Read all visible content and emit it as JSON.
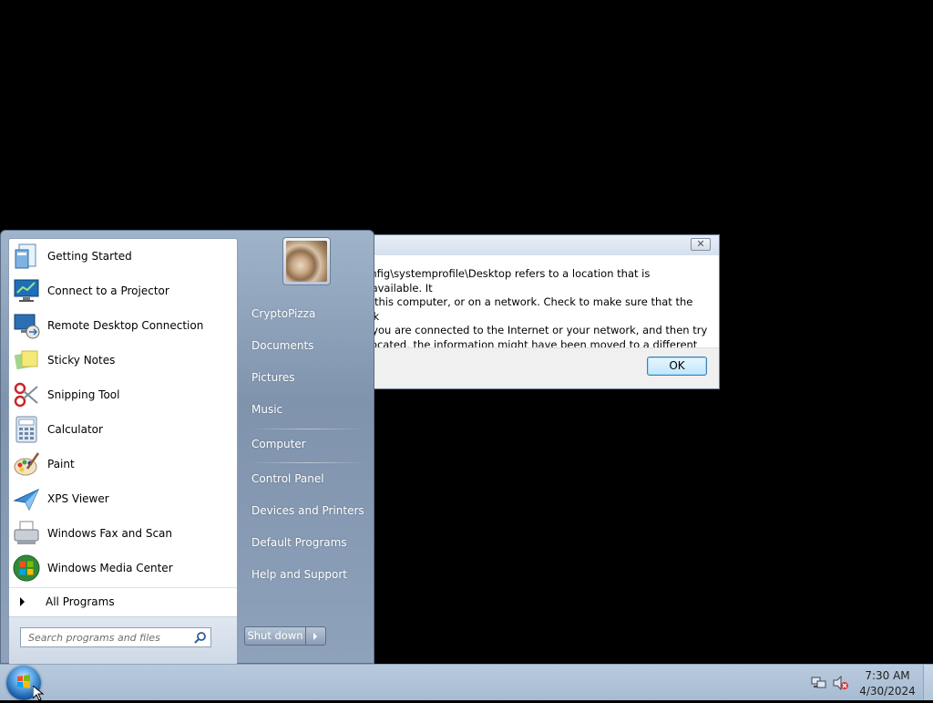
{
  "dialog": {
    "message": "config\\systemprofile\\Desktop refers to a location that is unavailable. It\n on this computer, or on a network. Check to make sure that the disk\nat you are connected to the Internet or your network, and then try\ne located, the information might have been moved to a different",
    "ok_label": "OK",
    "close_symbol": "✕"
  },
  "start_menu": {
    "programs": [
      {
        "label": "Getting Started",
        "icon": "getting-started-icon"
      },
      {
        "label": "Connect to a Projector",
        "icon": "projector-icon"
      },
      {
        "label": "Remote Desktop Connection",
        "icon": "remote-desktop-icon"
      },
      {
        "label": "Sticky Notes",
        "icon": "sticky-notes-icon"
      },
      {
        "label": "Snipping Tool",
        "icon": "snipping-tool-icon"
      },
      {
        "label": "Calculator",
        "icon": "calculator-icon"
      },
      {
        "label": "Paint",
        "icon": "paint-icon"
      },
      {
        "label": "XPS Viewer",
        "icon": "xps-viewer-icon"
      },
      {
        "label": "Windows Fax and Scan",
        "icon": "fax-scan-icon"
      },
      {
        "label": "Windows Media Center",
        "icon": "media-center-icon"
      }
    ],
    "all_programs_label": "All Programs",
    "search_placeholder": "Search programs and files",
    "right_items": {
      "user": "CryptoPizza",
      "documents": "Documents",
      "pictures": "Pictures",
      "music": "Music",
      "computer": "Computer",
      "control_panel": "Control Panel",
      "devices_printers": "Devices and Printers",
      "default_programs": "Default Programs",
      "help_support": "Help and Support"
    },
    "shutdown_label": "Shut down"
  },
  "taskbar": {
    "time": "7:30 AM",
    "date": "4/30/2024"
  }
}
